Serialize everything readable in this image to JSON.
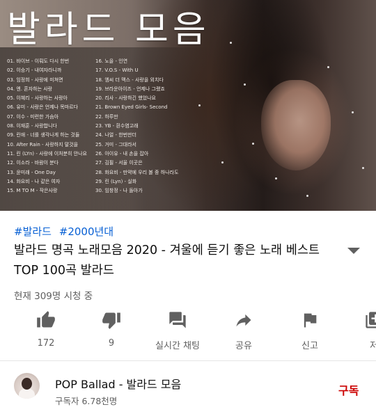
{
  "thumbnail": {
    "big_title": "발라드 모음",
    "tracks_left": [
      "01. 바이브 - 이뤄도 다시 한번",
      "02. 이승기 - 내여자라니까",
      "03. 임정희 - 사랑에 미쳐면",
      "04. 엔. 혼자하는 사랑",
      "05. 이혜리 - 사랑하는 사랑아",
      "06. 유미 - 사랑은 언제나 목마르다",
      "07. 이수 - 미련한 가슴아",
      "08. 이재훈 - 사랑합니다",
      "09. 린애 - 너를 생각나게 하는 것들",
      "10. After Rain - 사랑하지 말것을",
      "11. 린 (LYn) - 사랑에 이처분히 안나요",
      "12. 이소라 - 바람이 분다",
      "13. 윤미래 - One Day",
      "14. 화요비 - 나 같은 여자",
      "15. M TO M - 작은사랑"
    ],
    "tracks_right": [
      "16. 노을 - 인연",
      "17. V.O.S - With U",
      "18. 엠씨 더 맥스 - 사랑을 외치다",
      "19. 브라운아이즈 - 언제나 그랬죠",
      "20. 리사 - 사랑하긴 했었나요",
      "21. Brown Eyed Girls- Second",
      "22. 하루만",
      "23. YB - 흰수염고래",
      "24. 나얼 - 한번만더",
      "25. 거미 - 그대라서",
      "26. 아이유 - 내 손을 잡아",
      "27. 김필 - 서울 이곳은",
      "28. 화요비 - 만약에 우리 볼 중 하나라도",
      "29. 린 (Lyn) - 실화",
      "30. 임창정 - 나 돌아가"
    ]
  },
  "hashtags": [
    "#발라드",
    "#2000년대"
  ],
  "title": "발라드 명곡 노래모음 2020 - 겨울에 듣기 좋은 노래 베스트 TOP 100곡 발라드",
  "viewers": "현재 309명 시청 중",
  "actions": {
    "like": "172",
    "dislike": "9",
    "live_chat": "실시간 채팅",
    "share": "공유",
    "report": "신고",
    "save": "저"
  },
  "channel": {
    "name": "POP Ballad - 발라드 모음",
    "subscribers": "구독자 6.78천명",
    "subscribe_label": "구독"
  },
  "colors": {
    "hashtag": "#065fd4",
    "subscribe": "#cc0000",
    "icon": "#606060"
  }
}
